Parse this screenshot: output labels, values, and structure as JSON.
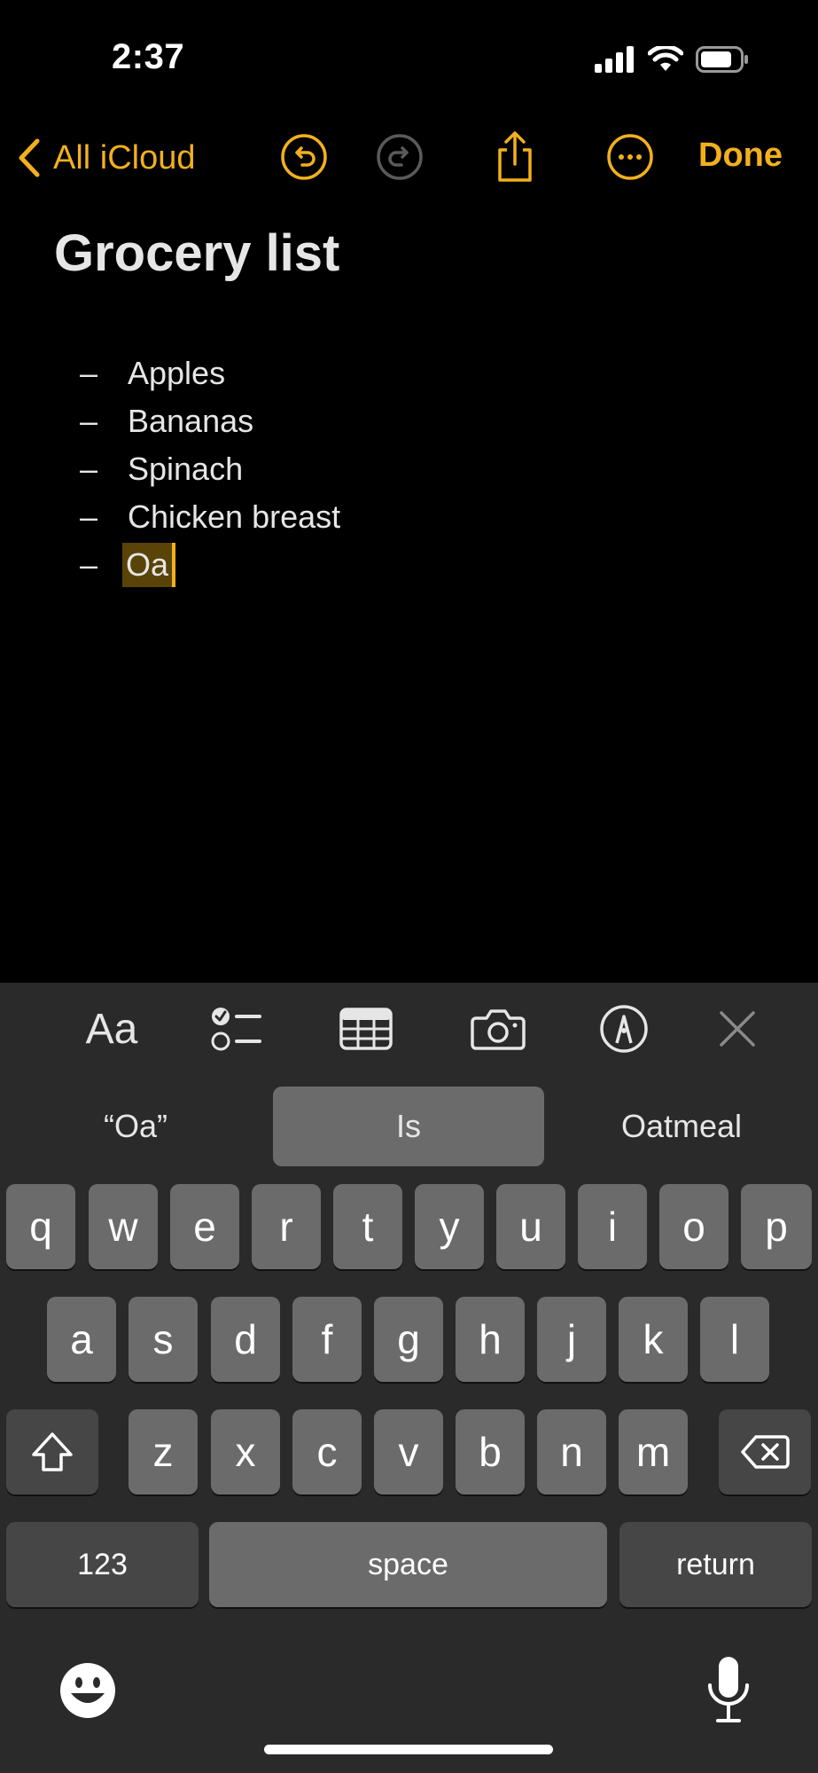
{
  "status_bar": {
    "time": "2:37"
  },
  "nav": {
    "back_label": "All iCloud",
    "done_label": "Done",
    "accent_color": "#f2b01e"
  },
  "note": {
    "title": "Grocery list",
    "bullet": "–",
    "items": [
      "Apples",
      "Bananas",
      "Spinach",
      "Chicken breast"
    ],
    "current_item": "Oa"
  },
  "toolbar": {
    "format_label": "Aa",
    "icons": [
      "checklist-icon",
      "table-icon",
      "camera-icon",
      "markup-icon",
      "close-icon"
    ]
  },
  "keyboard": {
    "suggestions": [
      "“Oa”",
      "Is",
      "Oatmeal"
    ],
    "row1": [
      "q",
      "w",
      "e",
      "r",
      "t",
      "y",
      "u",
      "i",
      "o",
      "p"
    ],
    "row2": [
      "a",
      "s",
      "d",
      "f",
      "g",
      "h",
      "j",
      "k",
      "l"
    ],
    "row3": [
      "z",
      "x",
      "c",
      "v",
      "b",
      "n",
      "m"
    ],
    "numbers_label": "123",
    "space_label": "space",
    "return_label": "return"
  }
}
